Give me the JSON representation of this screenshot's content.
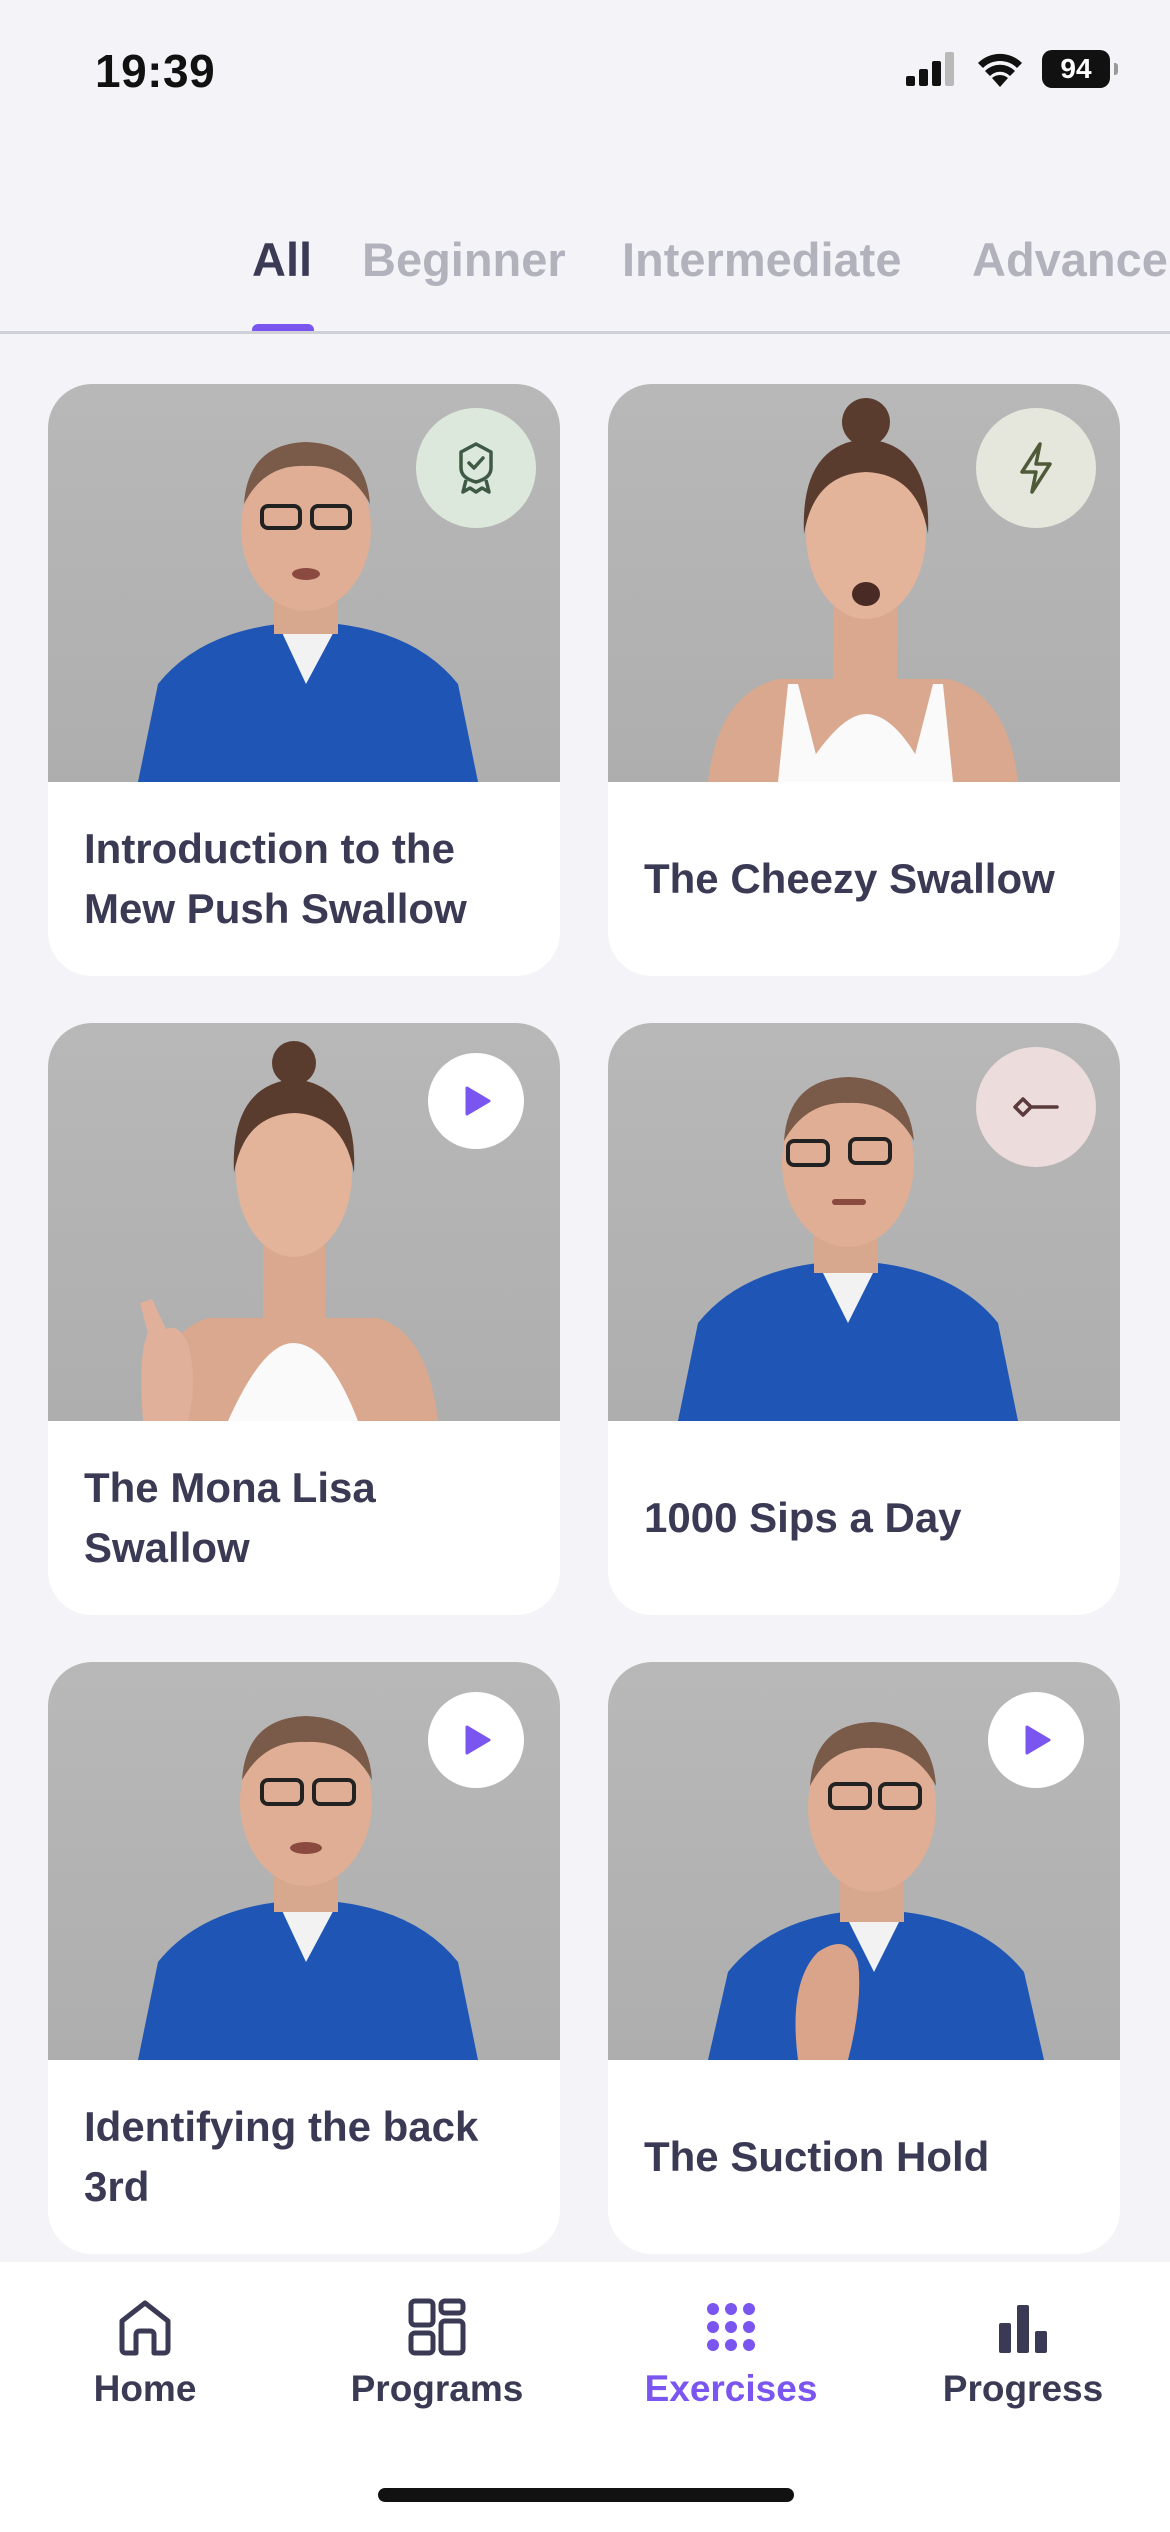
{
  "status_bar": {
    "time": "19:39",
    "battery": "94",
    "icons": [
      "signal-icon",
      "wifi-icon",
      "battery-icon"
    ]
  },
  "tabs": [
    {
      "label": "All",
      "active": true
    },
    {
      "label": "Beginner",
      "active": false
    },
    {
      "label": "Intermediate",
      "active": false
    },
    {
      "label": "Advance",
      "active": false
    }
  ],
  "exercises": [
    {
      "title": "Introduction to the Mew Push Swallow",
      "badge": "award-icon"
    },
    {
      "title": "The Cheezy Swallow",
      "badge": "bolt-icon"
    },
    {
      "title": "The Mona Lisa Swallow",
      "badge": "play-icon"
    },
    {
      "title": "1000 Sips a Day",
      "badge": "key-icon"
    },
    {
      "title": "Identifying the back 3rd",
      "badge": "play-icon"
    },
    {
      "title": "The Suction Hold",
      "badge": "play-icon"
    }
  ],
  "nav": [
    {
      "label": "Home",
      "icon": "home-icon",
      "active": false
    },
    {
      "label": "Programs",
      "icon": "grid-icon",
      "active": false
    },
    {
      "label": "Exercises",
      "icon": "dots-grid-icon",
      "active": true
    },
    {
      "label": "Progress",
      "icon": "bar-chart-icon",
      "active": false
    }
  ],
  "colors": {
    "accent": "#7b55f0",
    "text": "#3a3a55",
    "inactive_tab": "#b2b2bc",
    "background": "#f4f4f8"
  }
}
